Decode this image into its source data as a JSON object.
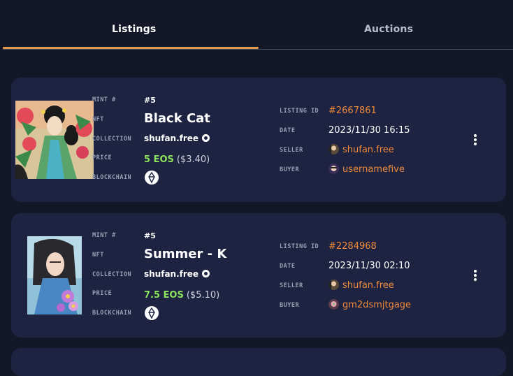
{
  "tabs": [
    {
      "label": "Listings"
    },
    {
      "label": "Auctions"
    }
  ],
  "labels": {
    "mint": "MINT #",
    "nft": "NFT",
    "collection": "COLLECTION",
    "price": "PRICE",
    "blockchain": "BLOCKCHAIN",
    "listing_id": "LISTING ID",
    "date": "DATE",
    "seller": "SELLER",
    "buyer": "BUYER"
  },
  "listings": [
    {
      "mint": "#5",
      "name": "Black Cat",
      "collection": "shufan.free",
      "price_eos": "5 EOS",
      "price_usd": "($3.40)",
      "blockchain_icon": "eos-icon",
      "listing_id": "#2667861",
      "date": "2023/11/30 16:15",
      "seller": "shufan.free",
      "buyer": "usernamefive"
    },
    {
      "mint": "#5",
      "name": "Summer - K",
      "collection": "shufan.free",
      "price_eos": "7.5 EOS",
      "price_usd": "($5.10)",
      "blockchain_icon": "eos-icon",
      "listing_id": "#2284968",
      "date": "2023/11/30 02:10",
      "seller": "shufan.free",
      "buyer": "gm2dsmjtgage"
    }
  ],
  "colors": {
    "background": "#131728",
    "card": "#1d2340",
    "accent": "#e39a4a",
    "link": "#f08a3c",
    "price": "#8ee35c"
  }
}
